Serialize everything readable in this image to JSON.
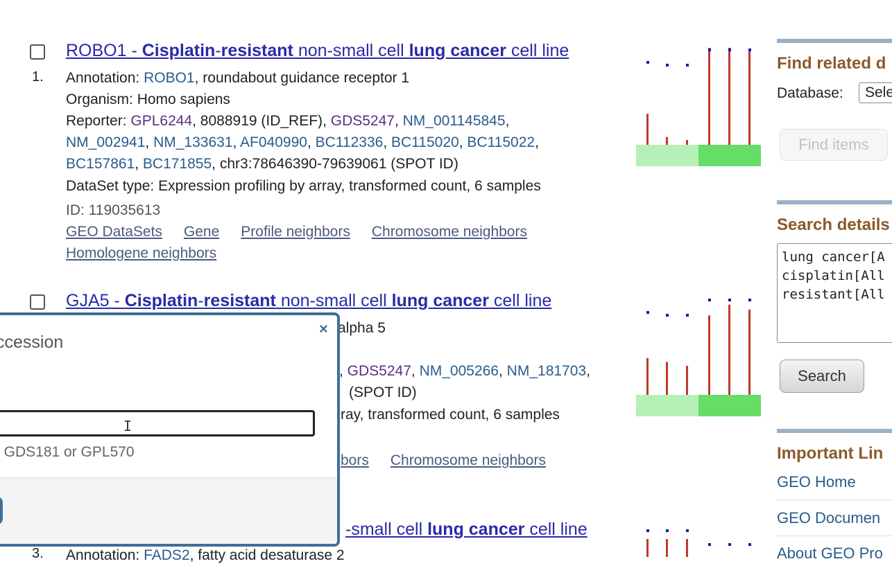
{
  "results": [
    {
      "number": "1.",
      "title_prefix": "ROBO1 - ",
      "title_bold1": "Cisplatin",
      "title_mid1": "-",
      "title_bold2": "resistant",
      "title_mid2": " non-small cell ",
      "title_bold3": "lung cancer",
      "title_end": " cell line",
      "annotation_label": "Annotation: ",
      "annotation_gene": "ROBO1",
      "annotation_desc": ", roundabout guidance receptor 1",
      "organism": "Organism: Homo sapiens",
      "reporter_label": "Reporter: ",
      "reporter_items_1": [
        "GPL6244",
        "8088919 (ID_REF)",
        "GDS5247",
        "NM_001145845"
      ],
      "reporter_items_2": [
        "NM_002941",
        "NM_133631",
        "AF040990",
        "BC112336",
        "BC115020",
        "BC115022"
      ],
      "reporter_items_3": [
        "BC157861",
        "BC171855",
        "chr3:78646390-79639061 (SPOT ID)"
      ],
      "dataset_type": "DataSet type: Expression profiling by array, transformed count, 6 samples",
      "id": "ID: 119035613",
      "links": [
        "GEO DataSets",
        "Gene",
        "Profile neighbors",
        "Chromosome neighbors"
      ],
      "links2": [
        "Homologene neighbors"
      ]
    },
    {
      "title_prefix": "GJA5 - ",
      "title_bold1": "Cisplatin",
      "title_mid1": "-",
      "title_bold2": "resistant",
      "title_mid2": " non-small cell ",
      "title_bold3": "lung cancer",
      "title_end": " cell line",
      "annotation_partial": "alpha 5",
      "reporter_partial": [
        "GDS5247",
        "NM_005266",
        "NM_181703"
      ],
      "spot_partial": "(SPOT ID)",
      "dataset_partial": "ray, transformed count, 6 samples",
      "links_partial": [
        "bors",
        "Chromosome neighbors"
      ]
    },
    {
      "number": "3.",
      "title_partial": "-small cell ",
      "title_bold": "lung cancer",
      "title_end": " cell line",
      "annotation_partial_label": "Annotation: ",
      "annotation_gene": "FADS2",
      "annotation_desc": ", fatty acid desaturase 2"
    }
  ],
  "sidebar": {
    "find_related_heading": "Find related d",
    "database_label": "Database:",
    "database_selected": "Sele",
    "find_items_button": "Find items",
    "search_details_heading": "Search details",
    "search_details_text": "lung cancer[A\ncisplatin[All\nresistant[All",
    "search_button": "Search",
    "important_links_heading": "Important Lin",
    "important_links": [
      "GEO Home",
      "GEO Documen",
      "About GEO Pro"
    ]
  },
  "modal": {
    "title": "ccession",
    "close": "×",
    "input_value": "",
    "hint": ": GDS181 or GPL570"
  },
  "chart_colors": {
    "bar": "#c0392b",
    "dot": "#1a1aa8",
    "base_light": "#b6f0b6",
    "base_dark": "#66dd66"
  },
  "charts": [
    {
      "dots": [
        1,
        1,
        1,
        1,
        1,
        1
      ],
      "bars": [
        0.32,
        0.08,
        0.05,
        1.0,
        1.0,
        0.98
      ]
    },
    {
      "dots": [
        1,
        1,
        1,
        1,
        1,
        1
      ],
      "bars": [
        0.38,
        0.34,
        0.3,
        0.82,
        0.93,
        0.88
      ]
    },
    {
      "dots": [
        1,
        1,
        1,
        1,
        1,
        1
      ],
      "bars": [
        0.2,
        0.2,
        0.2,
        0.2,
        0.2,
        0.2
      ]
    }
  ]
}
